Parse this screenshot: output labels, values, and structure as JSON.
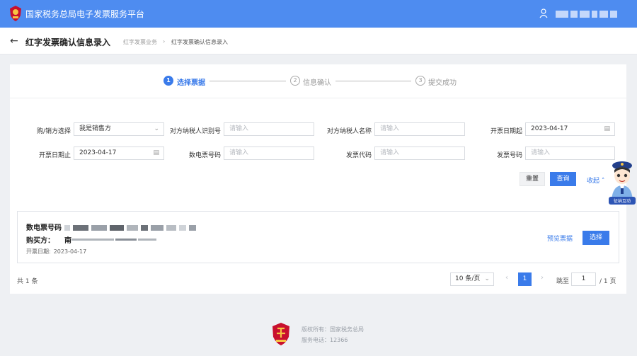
{
  "app": {
    "title": "国家税务总局电子发票服务平台"
  },
  "header": {
    "title": "红字发票确认信息录入",
    "breadcrumb": [
      "红字发票业务",
      "红字发票确认信息录入"
    ],
    "breadcrumb_sep": "›"
  },
  "steps": [
    {
      "num": "1",
      "label": "选择票据"
    },
    {
      "num": "2",
      "label": "信息确认"
    },
    {
      "num": "3",
      "label": "提交成功"
    }
  ],
  "filters": {
    "party": {
      "label": "购/销方选择",
      "value": "我是销售方"
    },
    "counterparty_id": {
      "label": "对方纳税人识别号",
      "placeholder": "请输入"
    },
    "counterparty_name": {
      "label": "对方纳税人名称",
      "placeholder": "请输入"
    },
    "date_start": {
      "label": "开票日期起",
      "value": "2023-04-17"
    },
    "date_end": {
      "label": "开票日期止",
      "value": "2023-04-17"
    },
    "e_invoice_no": {
      "label": "数电票号码",
      "placeholder": "请输入"
    },
    "invoice_code": {
      "label": "发票代码",
      "placeholder": "请输入"
    },
    "invoice_no": {
      "label": "发票号码",
      "placeholder": "请输入"
    }
  },
  "actions": {
    "reset": "重置",
    "query": "查询",
    "collapse": "收起",
    "collapse_icon": "chevron-up-icon"
  },
  "result": {
    "invoice_label": "数电票号码",
    "buyer_label": "购买方：",
    "buyer_value": "南",
    "date_label": "开票日期:",
    "date_value": "2023-04-17",
    "preview": "预览票据",
    "select": "选择"
  },
  "pagination": {
    "total": "共 1 条",
    "page_size": "10 条/页",
    "current": "1",
    "jump_label": "跳至",
    "jump_value": "1",
    "total_pages": "/ 1 页"
  },
  "footer": {
    "copyright": "版权所有：国家税务总局",
    "hotline": "服务电话：12366"
  },
  "mascot": {
    "caption": "征纳互动"
  },
  "colors": {
    "primary": "#3a7bea",
    "topbar": "#4e8cf0",
    "emblem": "#c8102e"
  }
}
